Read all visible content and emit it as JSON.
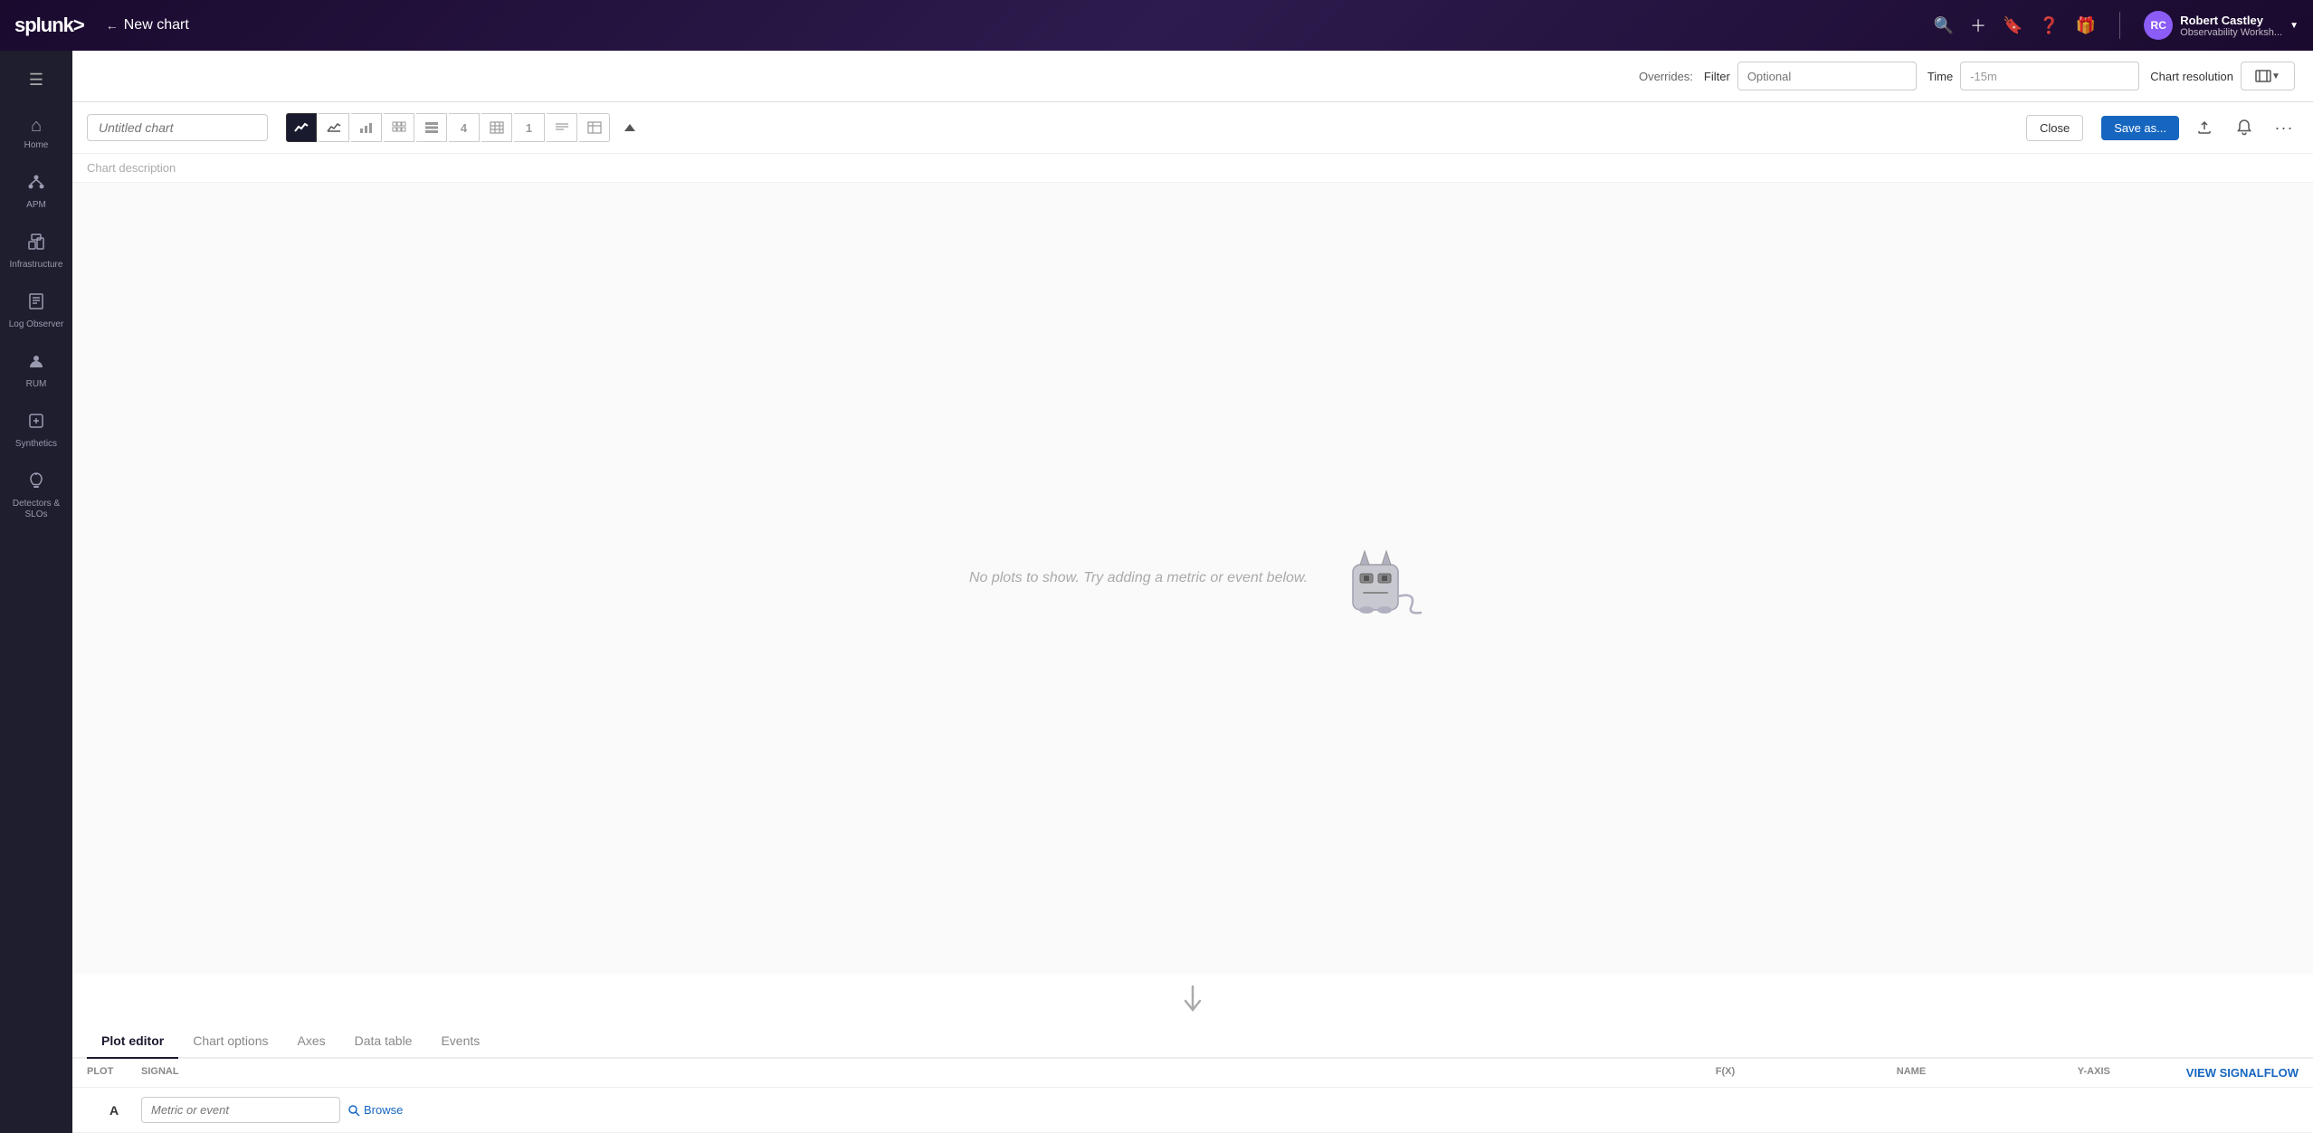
{
  "app": {
    "logo": "splunk>",
    "page_title": "New chart",
    "back_arrow": "←"
  },
  "nav": {
    "icons": [
      "search",
      "plus",
      "bookmark",
      "question",
      "gift"
    ],
    "user": {
      "name": "Robert Castley",
      "org": "Observability Worksh...",
      "initials": "RC"
    }
  },
  "sidebar": {
    "hamburger": "☰",
    "items": [
      {
        "id": "home",
        "label": "Home",
        "icon": "⌂"
      },
      {
        "id": "apm",
        "label": "APM",
        "icon": "⬡"
      },
      {
        "id": "infrastructure",
        "label": "Infrastructure",
        "icon": "👥"
      },
      {
        "id": "log-observer",
        "label": "Log Observer",
        "icon": "📋"
      },
      {
        "id": "rum",
        "label": "RUM",
        "icon": "👤"
      },
      {
        "id": "synthetics",
        "label": "Synthetics",
        "icon": "🔧"
      },
      {
        "id": "detectors",
        "label": "Detectors & SLOs",
        "icon": "🔔"
      }
    ]
  },
  "overrides": {
    "label": "Overrides:",
    "filter_label": "Filter",
    "filter_placeholder": "Optional",
    "time_label": "Time",
    "time_value": "-15m",
    "chart_resolution_label": "Chart resolution"
  },
  "chart": {
    "title_placeholder": "Untitled chart",
    "description_placeholder": "Chart description",
    "empty_message": "No plots to show. Try adding a metric or event below.",
    "chart_types": [
      {
        "id": "line",
        "icon": "📈",
        "active": true
      },
      {
        "id": "area",
        "icon": "▬"
      },
      {
        "id": "bar",
        "icon": "▐"
      },
      {
        "id": "grid",
        "icon": "⊞"
      },
      {
        "id": "list",
        "icon": "☰"
      },
      {
        "id": "num4",
        "icon": "4"
      },
      {
        "id": "heatmap",
        "icon": "▦"
      },
      {
        "id": "single",
        "icon": "1"
      },
      {
        "id": "text",
        "icon": "T"
      },
      {
        "id": "table",
        "icon": "⊟"
      }
    ],
    "close_label": "Close",
    "save_label": "Save as..."
  },
  "plot_editor": {
    "tabs": [
      {
        "id": "plot-editor",
        "label": "Plot editor",
        "active": true
      },
      {
        "id": "chart-options",
        "label": "Chart options",
        "active": false
      },
      {
        "id": "axes",
        "label": "Axes",
        "active": false
      },
      {
        "id": "data-table",
        "label": "Data table",
        "active": false
      },
      {
        "id": "events",
        "label": "Events",
        "active": false
      }
    ],
    "columns": [
      {
        "id": "plot",
        "label": "Plot"
      },
      {
        "id": "signal",
        "label": "Signal"
      },
      {
        "id": "fx",
        "label": "F(x)"
      },
      {
        "id": "name",
        "label": "Name"
      },
      {
        "id": "y-axis",
        "label": "Y-Axis"
      },
      {
        "id": "view-signalflow",
        "label": "View SignalFlow"
      }
    ],
    "rows": [
      {
        "letter": "A",
        "signal_placeholder": "Metric or event",
        "browse_label": "Browse"
      }
    ],
    "view_signalflow_label": "View SignalFlow"
  }
}
